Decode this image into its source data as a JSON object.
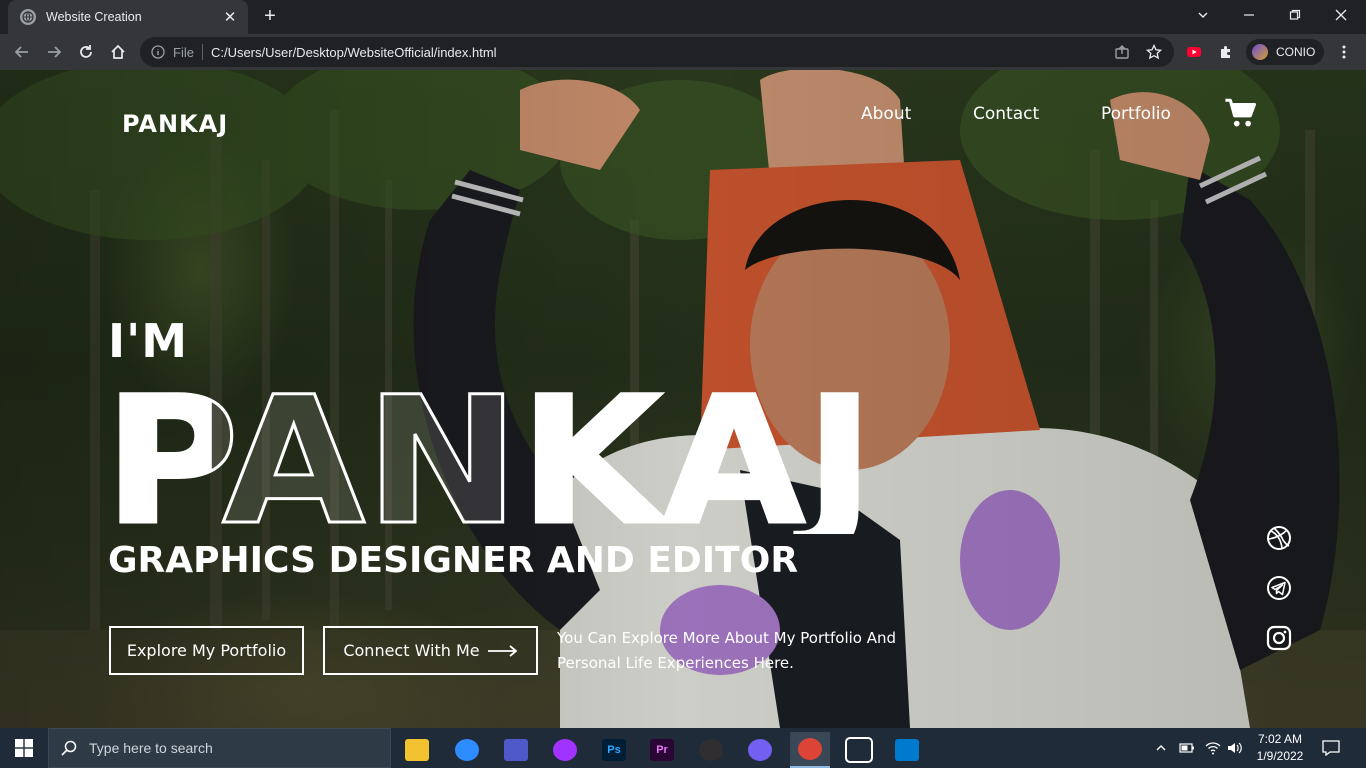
{
  "browser": {
    "tab_title": "Website Creation",
    "url_scheme": "File",
    "url": "C:/Users/User/Desktop/WebsiteOfficial/index.html",
    "profile_name": "CONIO"
  },
  "site": {
    "logo": "PANKAJ",
    "nav": [
      "About",
      "Contact",
      "Portfolio"
    ],
    "greeting": "I'M",
    "name": "PANKAJ",
    "role": "GRAPHICS DESIGNER AND EDITOR",
    "cta_primary": "Explore My Portfolio",
    "cta_secondary": "Connect With Me",
    "description_line1": "You Can Explore More About My Portfolio And",
    "description_line2": "Personal Life Experiences Here.",
    "social_icons": [
      "dribbble-icon",
      "telegram-icon",
      "instagram-icon"
    ]
  },
  "taskbar": {
    "search_placeholder": "Type here to search",
    "time": "7:02 AM",
    "date": "1/9/2022",
    "apps": [
      {
        "name": "file-explorer-icon",
        "color": "#f2c230",
        "label": ""
      },
      {
        "name": "zoom-icon",
        "color": "#2d8cff",
        "label": ""
      },
      {
        "name": "teams-icon",
        "color": "#5059c9",
        "label": ""
      },
      {
        "name": "messenger-icon",
        "color": "#a033ff",
        "label": ""
      },
      {
        "name": "photoshop-icon",
        "color": "#001e36",
        "label": "Ps"
      },
      {
        "name": "premiere-icon",
        "color": "#2a0634",
        "label": "Pr"
      },
      {
        "name": "obs-icon",
        "color": "#302e31",
        "label": ""
      },
      {
        "name": "viber-icon",
        "color": "#7360f2",
        "label": ""
      },
      {
        "name": "chrome-icon",
        "color": "#db4437",
        "label": ""
      },
      {
        "name": "app-icon",
        "color": "#ffffff",
        "label": ""
      },
      {
        "name": "vscode-icon",
        "color": "#007acc",
        "label": ""
      }
    ]
  }
}
